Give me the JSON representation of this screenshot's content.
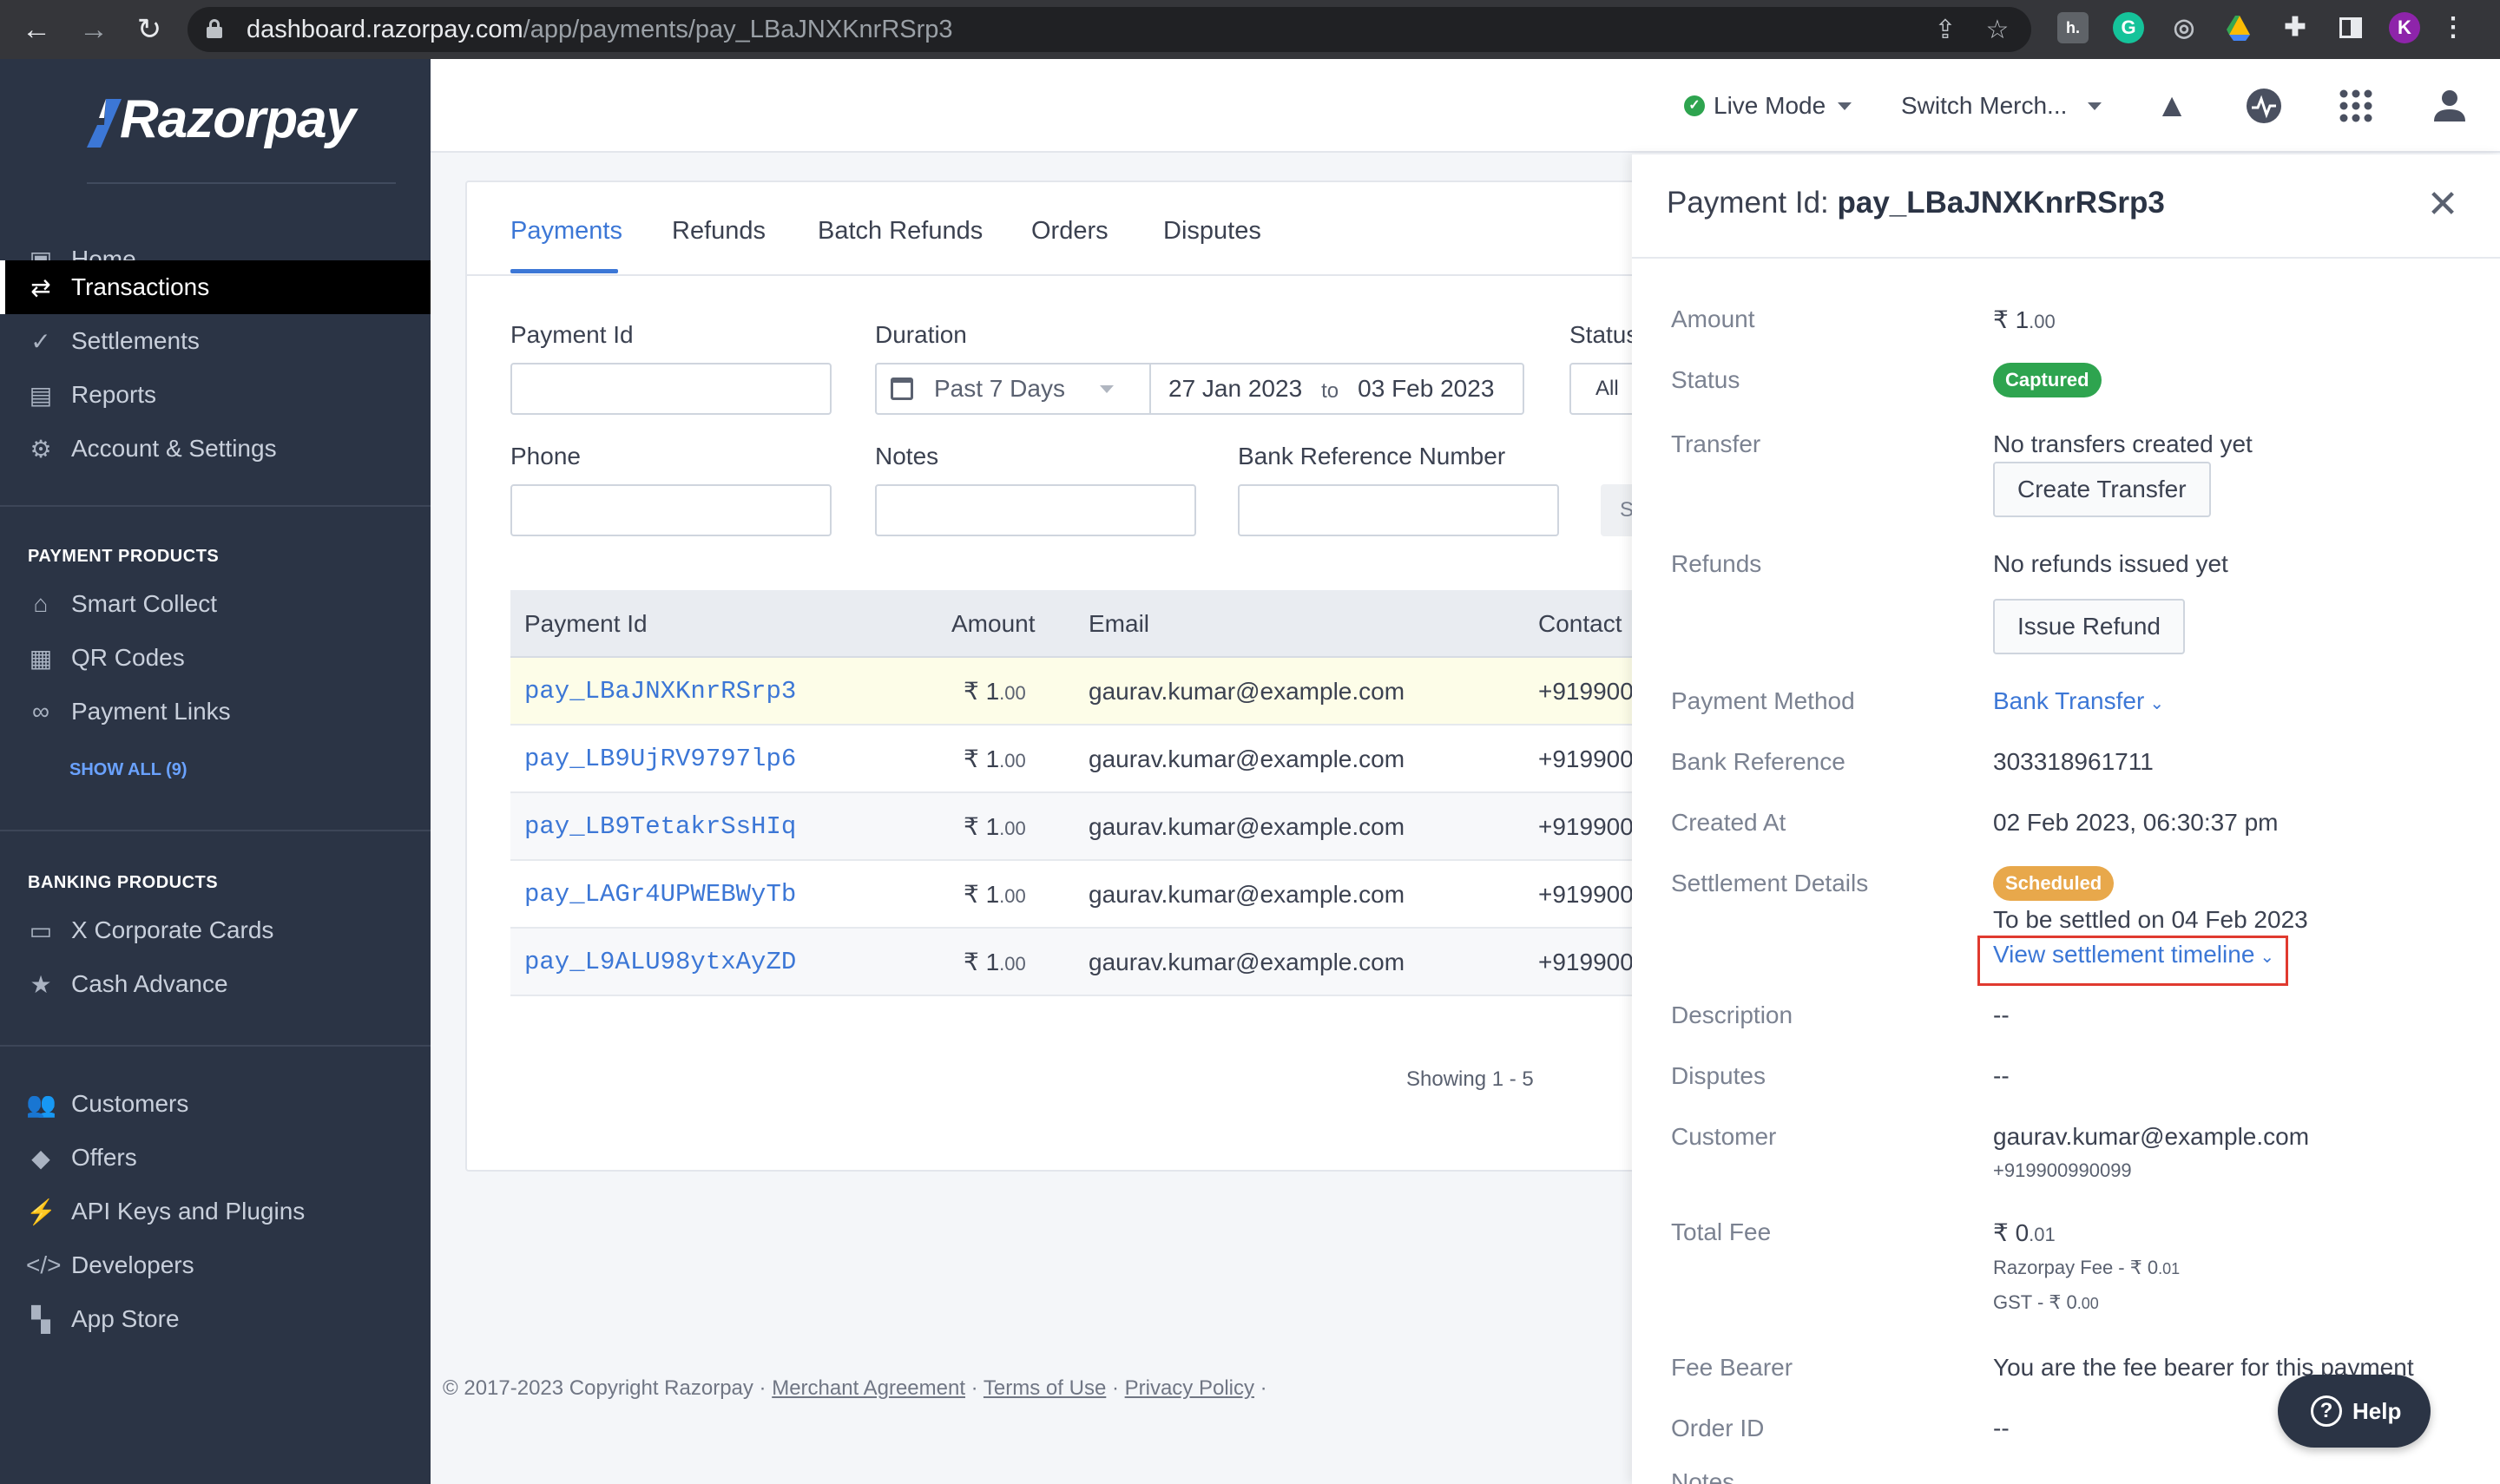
{
  "browser": {
    "url_host": "dashboard.razorpay.com",
    "url_path": "/app/payments/pay_LBaJNXKnrRSrp3",
    "profile_initial": "K",
    "grammarly_initial": "G",
    "honey_initial": "h."
  },
  "sidebar": {
    "logo_text": "Razorpay",
    "nav": [
      {
        "label": "Home",
        "icon": "home-icon"
      },
      {
        "label": "Transactions",
        "icon": "transactions-icon",
        "active": true
      },
      {
        "label": "Settlements",
        "icon": "settlements-icon"
      },
      {
        "label": "Reports",
        "icon": "reports-icon"
      },
      {
        "label": "Account & Settings",
        "icon": "gear-icon"
      }
    ],
    "payment_products_heading": "PAYMENT PRODUCTS",
    "payment_products": [
      {
        "label": "Smart Collect",
        "icon": "bank-icon"
      },
      {
        "label": "QR Codes",
        "icon": "qr-code-icon"
      },
      {
        "label": "Payment Links",
        "icon": "link-icon"
      }
    ],
    "show_all": "SHOW ALL (9)",
    "banking_products_heading": "BANKING PRODUCTS",
    "banking_products": [
      {
        "label": "X Corporate Cards",
        "icon": "card-icon"
      },
      {
        "label": "Cash Advance",
        "icon": "star-icon"
      }
    ],
    "more": [
      {
        "label": "Customers",
        "icon": "customers-icon"
      },
      {
        "label": "Offers",
        "icon": "tag-icon"
      },
      {
        "label": "API Keys and Plugins",
        "icon": "plug-icon"
      },
      {
        "label": "Developers",
        "icon": "code-icon"
      },
      {
        "label": "App Store",
        "icon": "app-store-icon"
      }
    ]
  },
  "header": {
    "mode": "Live Mode",
    "merchant": "Switch Merch..."
  },
  "tabs": [
    "Payments",
    "Refunds",
    "Batch Refunds",
    "Orders",
    "Disputes"
  ],
  "filters": {
    "payment_id_label": "Payment Id",
    "payment_id_value": "",
    "duration_label": "Duration",
    "duration_value": "Past 7 Days",
    "date_from": "27 Jan 2023",
    "date_to_sep": "to",
    "date_to": "03 Feb 2023",
    "status_label": "Status",
    "status_value": "All",
    "phone_label": "Phone",
    "notes_label": "Notes",
    "bank_ref_label": "Bank Reference Number",
    "search_label_partial": "S"
  },
  "table": {
    "headers": [
      "Payment Id",
      "Amount",
      "Email",
      "Contact"
    ],
    "rows": [
      {
        "id": "pay_LBaJNXKnrRSrp3",
        "amount_int": "₹ 1",
        "amount_dec": ".00",
        "email": "gaurav.kumar@example.com",
        "contact": "+919900"
      },
      {
        "id": "pay_LB9UjRV9797lp6",
        "amount_int": "₹ 1",
        "amount_dec": ".00",
        "email": "gaurav.kumar@example.com",
        "contact": "+919900"
      },
      {
        "id": "pay_LB9TetakrSsHIq",
        "amount_int": "₹ 1",
        "amount_dec": ".00",
        "email": "gaurav.kumar@example.com",
        "contact": "+919900"
      },
      {
        "id": "pay_LAGr4UPWEBWyTb",
        "amount_int": "₹ 1",
        "amount_dec": ".00",
        "email": "gaurav.kumar@example.com",
        "contact": "+919900"
      },
      {
        "id": "pay_L9ALU98ytxAyZD",
        "amount_int": "₹ 1",
        "amount_dec": ".00",
        "email": "gaurav.kumar@example.com",
        "contact": "+919900"
      }
    ],
    "showing": "Showing 1 - 5"
  },
  "footer": {
    "copyright": "© 2017-2023 Copyright Razorpay · ",
    "merchant_agreement": "Merchant Agreement",
    "sep1": " · ",
    "terms": "Terms of Use",
    "sep2": " · ",
    "privacy": "Privacy Policy",
    "sep3": " ·"
  },
  "drawer": {
    "title_prefix": "Payment Id: ",
    "title_id": "pay_LBaJNXKnrRSrp3",
    "amount_label": "Amount",
    "amount_int": "₹ 1",
    "amount_dec": ".00",
    "status_label": "Status",
    "status_value": "Captured",
    "transfer_label": "Transfer",
    "transfer_value": "No transfers created yet",
    "create_transfer": "Create Transfer",
    "refunds_label": "Refunds",
    "refunds_value": "No refunds issued yet",
    "issue_refund": "Issue Refund",
    "method_label": "Payment Method",
    "method_value": "Bank Transfer",
    "bank_ref_label": "Bank Reference",
    "bank_ref_value": "303318961711",
    "created_label": "Created At",
    "created_value": "02 Feb 2023, 06:30:37 pm",
    "settlement_label": "Settlement Details",
    "settlement_status": "Scheduled",
    "settlement_text": "To be settled on 04 Feb 2023",
    "settlement_link": "View settlement timeline",
    "description_label": "Description",
    "description_value": "--",
    "disputes_label": "Disputes",
    "disputes_value": "--",
    "customer_label": "Customer",
    "customer_email": "gaurav.kumar@example.com",
    "customer_phone": "+919900990099",
    "fee_label": "Total Fee",
    "fee_int": "₹ 0",
    "fee_dec": ".01",
    "razorpay_fee_label": "Razorpay Fee - ",
    "razorpay_fee_int": "₹ 0",
    "razorpay_fee_dec": ".01",
    "gst_label": "GST - ",
    "gst_int": "₹ 0",
    "gst_dec": ".00",
    "fee_bearer_label": "Fee Bearer",
    "fee_bearer_value": "You are the fee bearer for this payment",
    "order_label": "Order ID",
    "order_value": "--",
    "notes_label_partial": "Notes"
  },
  "help_label": "Help",
  "colors": {
    "sidebar_bg": "#2b3445",
    "accent_blue": "#3c77d6",
    "captured_green": "#2ea44f",
    "scheduled_orange": "#e8a84b",
    "highlight_red": "#e03a2f"
  }
}
